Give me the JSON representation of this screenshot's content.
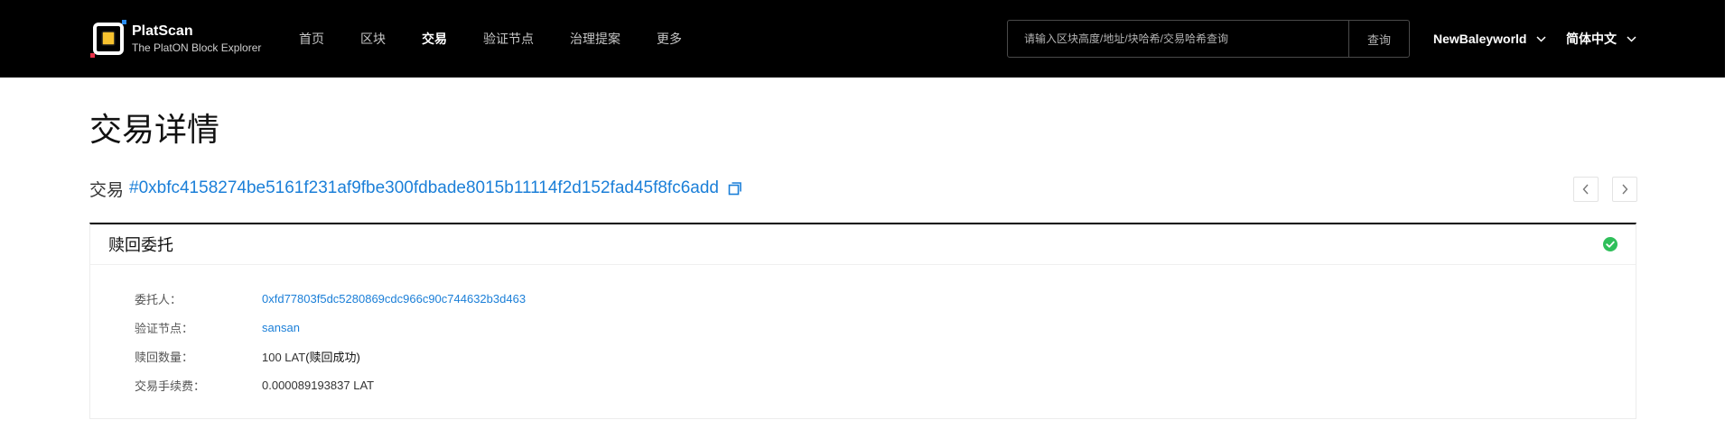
{
  "header": {
    "logo": {
      "title": "PlatScan",
      "subtitle": "The PlatON Block Explorer",
      "icon": "platscan-logo-icon"
    },
    "nav": [
      {
        "label": "首页",
        "active": false
      },
      {
        "label": "区块",
        "active": false
      },
      {
        "label": "交易",
        "active": true
      },
      {
        "label": "验证节点",
        "active": false
      },
      {
        "label": "治理提案",
        "active": false
      },
      {
        "label": "更多",
        "active": false
      }
    ],
    "search": {
      "placeholder": "请输入区块高度/地址/块哈希/交易哈希查询",
      "button_label": "查询"
    },
    "network": {
      "label": "NewBaleyworld",
      "icon": "chevron-down-icon"
    },
    "language": {
      "label": "简体中文",
      "icon": "chevron-down-icon"
    }
  },
  "page": {
    "title": "交易详情"
  },
  "transaction": {
    "label": "交易",
    "hash": "#0xbfc4158274be5161f231af9fbe300fdbade8015b11114f2d152fad45f8fc6add",
    "copy_icon": "copy-icon",
    "prev_icon": "chevron-left-icon",
    "next_icon": "chevron-right-icon"
  },
  "detail_card": {
    "title": "赎回委托",
    "status_icon": "success-check-icon",
    "rows": [
      {
        "label": "委托人：",
        "value": "0xfd77803f5dc5280869cdc966c90c744632b3d463"
      },
      {
        "label": "验证节点：",
        "value": "sansan"
      },
      {
        "label": "赎回数量：",
        "value": "100 LAT",
        "status": "(赎回成功)"
      },
      {
        "label": "交易手续费：",
        "value": "0.000089193837 LAT"
      }
    ]
  },
  "colors": {
    "header_bg": "#000000",
    "accent": "#1b7fd8",
    "success": "#2fbf5a",
    "logo_yellow": "#f7c22f",
    "logo_red": "#e8334a",
    "logo_blue": "#2a8cf0"
  }
}
